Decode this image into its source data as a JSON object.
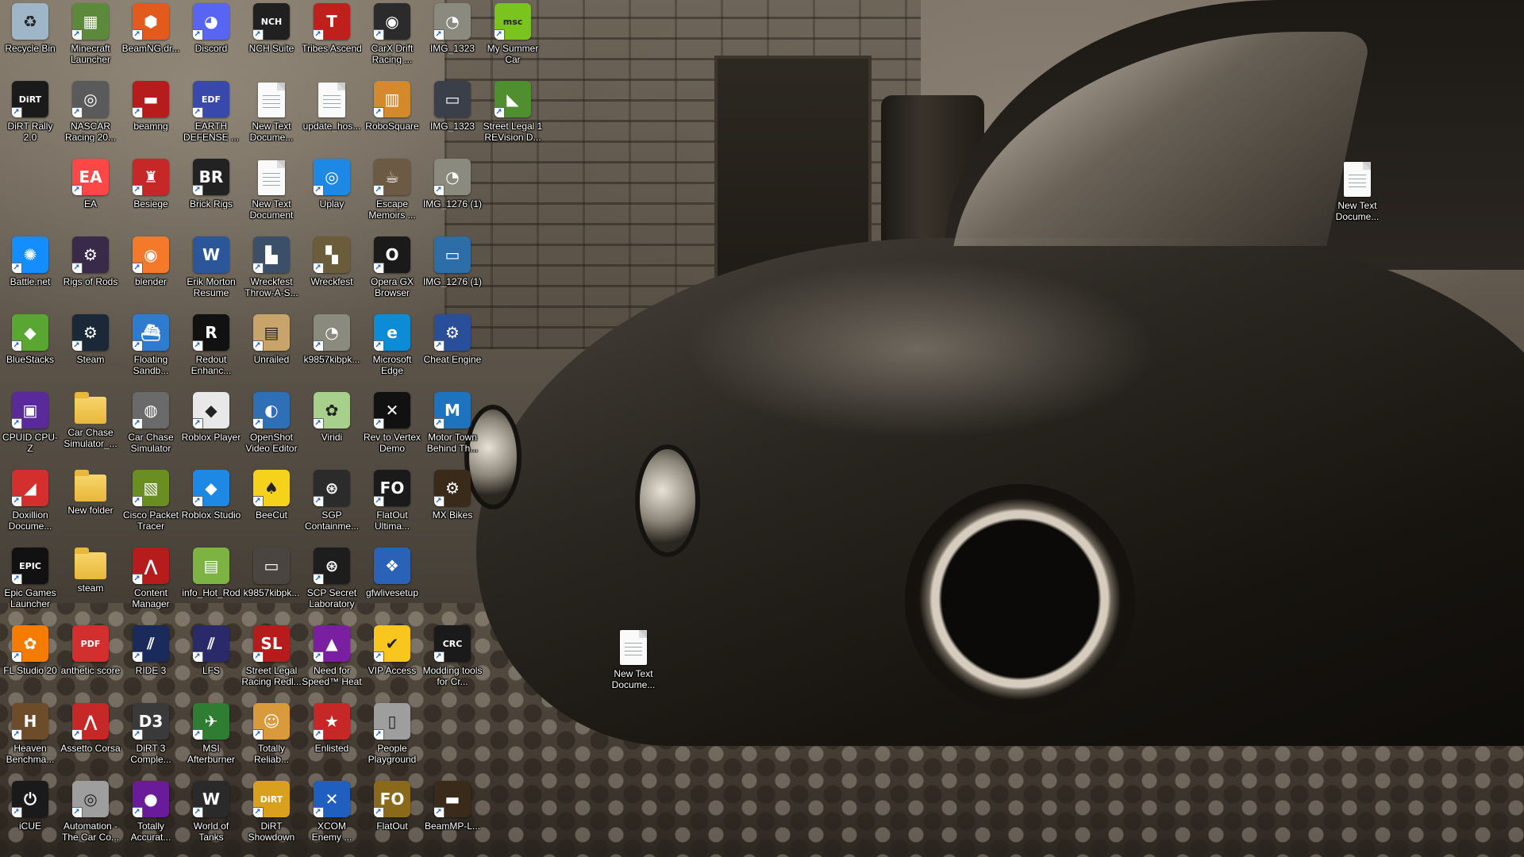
{
  "desktop": {
    "icons": [
      {
        "label": "Recycle Bin",
        "icon": "recycle-bin-icon",
        "glyph": "♻",
        "color": "#9fb6c8",
        "shortcut": false
      },
      {
        "label": "Minecraft Launcher",
        "icon": "minecraft-icon",
        "glyph": "▦",
        "color": "#5c8a3a",
        "shortcut": true
      },
      {
        "label": "BeamNG.dr...",
        "icon": "beamng-icon",
        "glyph": "⬢",
        "color": "#e35b1c",
        "shortcut": true
      },
      {
        "label": "Discord",
        "icon": "discord-icon",
        "glyph": "◕",
        "color": "#5865f2",
        "shortcut": true
      },
      {
        "label": "NCH Suite",
        "icon": "nch-suite-icon",
        "glyph": "NCH",
        "color": "#202020",
        "shortcut": true
      },
      {
        "label": "Tribes Ascend",
        "icon": "tribes-icon",
        "glyph": "T",
        "color": "#c0201b",
        "shortcut": true
      },
      {
        "label": "CarX Drift Racing ...",
        "icon": "carx-icon",
        "glyph": "◉",
        "color": "#2b2b2b",
        "shortcut": true
      },
      {
        "label": "IMG_1323",
        "icon": "gimp-image-icon",
        "glyph": "◔",
        "color": "#8a8a7e",
        "shortcut": true
      },
      {
        "label": "My Summer Car",
        "icon": "my-summer-car-icon",
        "glyph": "msc",
        "color": "#7bc31e",
        "shortcut": true
      },
      {
        "label": "DiRT Rally 2.0",
        "icon": "dirt-rally-icon",
        "glyph": "DiRT",
        "color": "#1a1a1a",
        "shortcut": true
      },
      {
        "label": "NASCAR Racing 20...",
        "icon": "nascar-icon",
        "glyph": "◎",
        "color": "#5a5a5a",
        "shortcut": true
      },
      {
        "label": "beamng",
        "icon": "beamng-car-icon",
        "glyph": "▬",
        "color": "#b71c1c",
        "shortcut": true
      },
      {
        "label": "EARTH DEFENSE ...",
        "icon": "earth-defense-icon",
        "glyph": "EDF",
        "color": "#3949ab",
        "shortcut": true
      },
      {
        "label": "New Text Docume...",
        "icon": "text-document-icon",
        "glyph": "doc",
        "color": "#ffffff",
        "shortcut": false
      },
      {
        "label": "update_hos...",
        "icon": "blank-file-icon",
        "glyph": "doc",
        "color": "#ffffff",
        "shortcut": false
      },
      {
        "label": "RoboSquare",
        "icon": "robosquare-icon",
        "glyph": "▥",
        "color": "#d48a2a",
        "shortcut": true
      },
      {
        "label": "IMG_1323",
        "icon": "image-photo-icon",
        "glyph": "▭",
        "color": "#3a3f4a",
        "shortcut": false
      },
      {
        "label": "Street Legal 1 REVision D...",
        "icon": "street-legal-icon",
        "glyph": "◣",
        "color": "#4f8f2f",
        "shortcut": true
      },
      {
        "label": "EA",
        "icon": "ea-icon",
        "glyph": "EA",
        "color": "#ff4747",
        "shortcut": true
      },
      {
        "label": "Besiege",
        "icon": "besiege-icon",
        "glyph": "♜",
        "color": "#c62828",
        "shortcut": true
      },
      {
        "label": "Brick Rigs",
        "icon": "brick-rigs-icon",
        "glyph": "BR",
        "color": "#222222",
        "shortcut": true
      },
      {
        "label": "New Text Document",
        "icon": "text-document-icon",
        "glyph": "doc",
        "color": "#ffffff",
        "shortcut": false
      },
      {
        "label": "Uplay",
        "icon": "uplay-icon",
        "glyph": "◎",
        "color": "#1e88e5",
        "shortcut": true
      },
      {
        "label": "Escape Memoirs ...",
        "icon": "escape-memoirs-icon",
        "glyph": "☕",
        "color": "#6d5a45",
        "shortcut": true
      },
      {
        "label": "IMG_1276 (1)",
        "icon": "gimp-image-icon",
        "glyph": "◔",
        "color": "#8a8a7e",
        "shortcut": true
      },
      {
        "label": "Battle.net",
        "icon": "battlenet-icon",
        "glyph": "✺",
        "color": "#148eff",
        "shortcut": true
      },
      {
        "label": "Rigs of Rods",
        "icon": "rigs-of-rods-icon",
        "glyph": "⚙",
        "color": "#3a2a4a",
        "shortcut": true
      },
      {
        "label": "blender",
        "icon": "blender-icon",
        "glyph": "◉",
        "color": "#f5792a",
        "shortcut": true
      },
      {
        "label": "Erik Morton Resume",
        "icon": "word-document-icon",
        "glyph": "W",
        "color": "#2b579a",
        "shortcut": false
      },
      {
        "label": "Wreckfest Throw-A-S...",
        "icon": "wreckfest-taso-icon",
        "glyph": "▙",
        "color": "#3b5068",
        "shortcut": true
      },
      {
        "label": "Wreckfest",
        "icon": "wreckfest-icon",
        "glyph": "▚",
        "color": "#6b5c3a",
        "shortcut": true
      },
      {
        "label": "Opera GX Browser",
        "icon": "opera-gx-icon",
        "glyph": "O",
        "color": "#1a1a1a",
        "shortcut": true
      },
      {
        "label": "IMG_1276 (1)",
        "icon": "image-photo-icon",
        "glyph": "▭",
        "color": "#2d6ea8",
        "shortcut": false
      },
      {
        "label": "BlueStacks",
        "icon": "bluestacks-icon",
        "glyph": "◆",
        "color": "#5aa632",
        "shortcut": true
      },
      {
        "label": "Steam",
        "icon": "steam-icon",
        "glyph": "⚙",
        "color": "#1b2838",
        "shortcut": true
      },
      {
        "label": "Floating Sandb...",
        "icon": "floating-sandbox-icon",
        "glyph": "⛴",
        "color": "#2e7bcf",
        "shortcut": true
      },
      {
        "label": "Redout Enhanc...",
        "icon": "redout-icon",
        "glyph": "R",
        "color": "#111111",
        "shortcut": true
      },
      {
        "label": "Unrailed",
        "icon": "unrailed-icon",
        "glyph": "▤",
        "color": "#c8a46a",
        "shortcut": true
      },
      {
        "label": "k9857kibpk...",
        "icon": "gimp-image-icon",
        "glyph": "◔",
        "color": "#8a8a7e",
        "shortcut": true
      },
      {
        "label": "Microsoft Edge",
        "icon": "edge-icon",
        "glyph": "e",
        "color": "#0c8bd6",
        "shortcut": true
      },
      {
        "label": "Cheat Engine",
        "icon": "cheat-engine-icon",
        "glyph": "⚙",
        "color": "#2a4f9a",
        "shortcut": true
      },
      {
        "label": "CPUID CPU-Z",
        "icon": "cpu-z-icon",
        "glyph": "▣",
        "color": "#5b2a9a",
        "shortcut": true
      },
      {
        "label": "Car Chase Simulator_...",
        "icon": "folder-icon",
        "glyph": "folder",
        "color": "#f6d56a",
        "shortcut": false
      },
      {
        "label": "Car Chase Simulator",
        "icon": "car-chase-icon",
        "glyph": "◍",
        "color": "#6a6a6a",
        "shortcut": true
      },
      {
        "label": "Roblox Player",
        "icon": "roblox-icon",
        "glyph": "◆",
        "color": "#e8e8e8",
        "shortcut": true
      },
      {
        "label": "OpenShot Video Editor",
        "icon": "openshot-icon",
        "glyph": "◐",
        "color": "#2f6fb5",
        "shortcut": true
      },
      {
        "label": "Viridi",
        "icon": "viridi-icon",
        "glyph": "✿",
        "color": "#a8d08d",
        "shortcut": true
      },
      {
        "label": "Rev to Vertex Demo",
        "icon": "rev-to-vertex-icon",
        "glyph": "✕",
        "color": "#111111",
        "shortcut": true
      },
      {
        "label": "Motor Town Behind Th...",
        "icon": "motor-town-icon",
        "glyph": "M",
        "color": "#1e73be",
        "shortcut": true
      },
      {
        "label": "Doxillion Docume...",
        "icon": "doxillion-icon",
        "glyph": "◢",
        "color": "#d32f2f",
        "shortcut": true
      },
      {
        "label": "New folder",
        "icon": "folder-icon",
        "glyph": "folder",
        "color": "#f6d56a",
        "shortcut": false
      },
      {
        "label": "Cisco Packet Tracer",
        "icon": "cisco-packet-tracer-icon",
        "glyph": "▧",
        "color": "#6b8e23",
        "shortcut": true
      },
      {
        "label": "Roblox Studio",
        "icon": "roblox-studio-icon",
        "glyph": "◆",
        "color": "#1e88e5",
        "shortcut": true
      },
      {
        "label": "BeeCut",
        "icon": "beecut-icon",
        "glyph": "♠",
        "color": "#f7d21c",
        "shortcut": true
      },
      {
        "label": "SGP Containme...",
        "icon": "scp-icon",
        "glyph": "⊛",
        "color": "#2b2b2b",
        "shortcut": true
      },
      {
        "label": "FlatOut Ultima...",
        "icon": "flatout-ultimate-icon",
        "glyph": "FO",
        "color": "#1a1a1a",
        "shortcut": true
      },
      {
        "label": "MX Bikes",
        "icon": "mx-bikes-icon",
        "glyph": "⚙",
        "color": "#3a2a1a",
        "shortcut": true
      },
      {
        "label": "Epic Games Launcher",
        "icon": "epic-games-icon",
        "glyph": "EPIC",
        "color": "#111111",
        "shortcut": true
      },
      {
        "label": "steam",
        "icon": "folder-icon",
        "glyph": "folder",
        "color": "#f6d56a",
        "shortcut": false
      },
      {
        "label": "Content Manager",
        "icon": "content-manager-icon",
        "glyph": "⋀",
        "color": "#b71c1c",
        "shortcut": true
      },
      {
        "label": "info_Hot_Rod",
        "icon": "text-file-icon",
        "glyph": "▤",
        "color": "#7cb342",
        "shortcut": false
      },
      {
        "label": "k9857kibpk...",
        "icon": "image-photo-icon",
        "glyph": "▭",
        "color": "#4a4540",
        "shortcut": false
      },
      {
        "label": "SCP Secret Laboratory",
        "icon": "scp-sl-icon",
        "glyph": "⊛",
        "color": "#1d1d1d",
        "shortcut": true
      },
      {
        "label": "gfwlivesetup",
        "icon": "windows-setup-icon",
        "glyph": "❖",
        "color": "#2a62b8",
        "shortcut": false
      },
      {
        "label": "FL Studio 20",
        "icon": "fl-studio-icon",
        "glyph": "✿",
        "color": "#f57c00",
        "shortcut": true
      },
      {
        "label": "anthetic score",
        "icon": "pdf-icon",
        "glyph": "PDF",
        "color": "#d32f2f",
        "shortcut": false
      },
      {
        "label": "RIDE 3",
        "icon": "ride3-icon",
        "glyph": "⫽",
        "color": "#1a2a5a",
        "shortcut": true
      },
      {
        "label": "LFS",
        "icon": "lfs-icon",
        "glyph": "⫽",
        "color": "#2a2a6a",
        "shortcut": true
      },
      {
        "label": "Street Legal Racing Redl...",
        "icon": "slrr-icon",
        "glyph": "SL",
        "color": "#b71c1c",
        "shortcut": true
      },
      {
        "label": "Need for Speed™ Heat",
        "icon": "nfs-heat-icon",
        "glyph": "▲",
        "color": "#7b1fa2",
        "shortcut": true
      },
      {
        "label": "VIP Access",
        "icon": "vip-access-icon",
        "glyph": "✔",
        "color": "#f9c61d",
        "shortcut": true
      },
      {
        "label": "Modding tools for Cr...",
        "icon": "crc-modding-icon",
        "glyph": "CRC",
        "color": "#1a1a1a",
        "shortcut": true
      },
      {
        "label": "Heaven Benchma...",
        "icon": "heaven-benchmark-icon",
        "glyph": "H",
        "color": "#6d4c2a",
        "shortcut": true
      },
      {
        "label": "Assetto Corsa",
        "icon": "assetto-corsa-icon",
        "glyph": "⋀",
        "color": "#c62828",
        "shortcut": true
      },
      {
        "label": "DiRT 3 Comple...",
        "icon": "dirt3-icon",
        "glyph": "D3",
        "color": "#3a3a3a",
        "shortcut": true
      },
      {
        "label": "MSI Afterburner",
        "icon": "msi-afterburner-icon",
        "glyph": "✈",
        "color": "#2e7d32",
        "shortcut": true
      },
      {
        "label": "Totally Reliab...",
        "icon": "totally-reliable-icon",
        "glyph": "☺",
        "color": "#d89a3a",
        "shortcut": true
      },
      {
        "label": "Enlisted",
        "icon": "enlisted-icon",
        "glyph": "★",
        "color": "#c62828",
        "shortcut": true
      },
      {
        "label": "People Playground",
        "icon": "people-playground-icon",
        "glyph": "▯",
        "color": "#9e9e9e",
        "shortcut": true
      },
      {
        "label": "iCUE",
        "icon": "icue-icon",
        "glyph": "⏻",
        "color": "#1a1a1a",
        "shortcut": true
      },
      {
        "label": "Automation - The Car Co...",
        "icon": "automation-icon",
        "glyph": "◎",
        "color": "#9e9e9e",
        "shortcut": true
      },
      {
        "label": "Totally Accurat...",
        "icon": "tabs-icon",
        "glyph": "●",
        "color": "#6a1b9a",
        "shortcut": true
      },
      {
        "label": "World of Tanks",
        "icon": "world-of-tanks-icon",
        "glyph": "W",
        "color": "#2a2a2a",
        "shortcut": true
      },
      {
        "label": "DiRT Showdown",
        "icon": "dirt-showdown-icon",
        "glyph": "DiRT",
        "color": "#d8a01c",
        "shortcut": true
      },
      {
        "label": "XCOM Enemy ...",
        "icon": "xcom-icon",
        "glyph": "✕",
        "color": "#1e5fbf",
        "shortcut": true
      },
      {
        "label": "FlatOut",
        "icon": "flatout-icon",
        "glyph": "FO",
        "color": "#8a6a1a",
        "shortcut": true
      },
      {
        "label": "BeamMP-L...",
        "icon": "beammp-icon",
        "glyph": "▬",
        "color": "#3a2a1a",
        "shortcut": true
      },
      {
        "label": "New Text Docume...",
        "icon": "text-document-icon",
        "glyph": "doc",
        "color": "#ffffff",
        "shortcut": false
      },
      {
        "label": "New Text Docume...",
        "icon": "text-document-icon",
        "glyph": "doc",
        "color": "#ffffff",
        "shortcut": false
      }
    ]
  },
  "wallpaper": {
    "subject": "sepia-tone classic sports car on cobblestone street"
  }
}
